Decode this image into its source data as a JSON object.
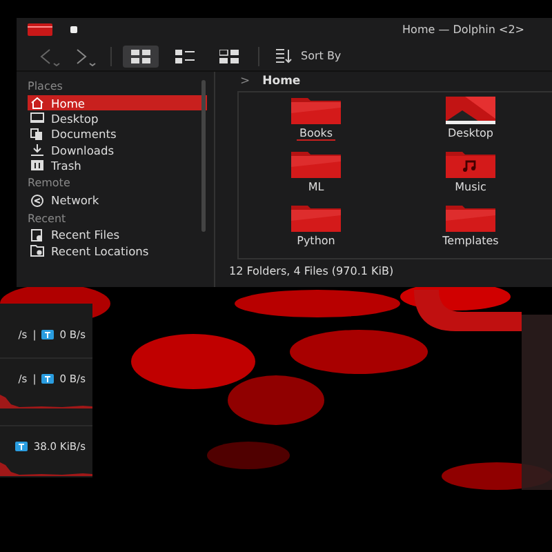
{
  "window": {
    "title": "Home — Dolphin <2>"
  },
  "toolbar": {
    "views": [
      {
        "kind": "icons",
        "selected": true
      },
      {
        "kind": "compact",
        "selected": false
      },
      {
        "kind": "details",
        "selected": false
      }
    ],
    "sort_label": "Sort By"
  },
  "places": [
    {
      "heading": "Places",
      "items": [
        {
          "kind": "home",
          "label": "Home",
          "selected": true
        },
        {
          "kind": "desktop",
          "label": "Desktop",
          "selected": false
        },
        {
          "kind": "documents",
          "label": "Documents",
          "selected": false
        },
        {
          "kind": "downloads",
          "label": "Downloads",
          "selected": false
        },
        {
          "kind": "trash",
          "label": "Trash",
          "selected": false
        }
      ]
    },
    {
      "heading": "Remote",
      "items": [
        {
          "kind": "network",
          "label": "Network",
          "selected": false
        }
      ]
    },
    {
      "heading": "Recent",
      "items": [
        {
          "kind": "recent-files",
          "label": "Recent Files",
          "selected": false
        },
        {
          "kind": "recent-locations",
          "label": "Recent Locations",
          "selected": false
        }
      ]
    }
  ],
  "breadcrumb": {
    "separator": ">",
    "location": "Home"
  },
  "files": [
    {
      "kind": "folder",
      "name": "Books",
      "selected": true
    },
    {
      "kind": "desktop",
      "name": "Desktop",
      "selected": false
    },
    {
      "kind": "folder",
      "name": "ML",
      "selected": false
    },
    {
      "kind": "music",
      "name": "Music",
      "selected": false
    },
    {
      "kind": "folder",
      "name": "Python",
      "selected": false
    },
    {
      "kind": "folder",
      "name": "Templates",
      "selected": false
    }
  ],
  "status_bar": "12 Folders, 4 Files (970.1 KiB)",
  "network_widget": {
    "rows": [
      {
        "download": "/s",
        "separator": "|",
        "upload": "0 B/s",
        "graph": false
      },
      {
        "download": "/s",
        "separator": "|",
        "upload": "0 B/s",
        "graph": true
      },
      {
        "upload": "38.0 KiB/s",
        "graph": true
      }
    ]
  }
}
